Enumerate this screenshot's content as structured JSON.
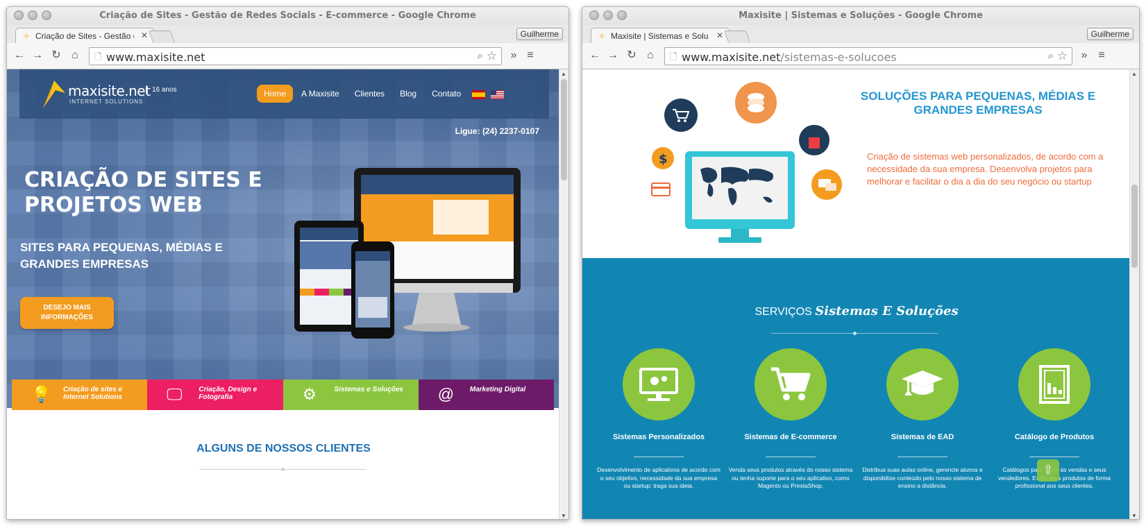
{
  "left_window": {
    "window_title": "Criação de Sites - Gestão de Redes Sociais - E-commerce - Google Chrome",
    "tab_title": "Criação de Sites - Gestão d",
    "profile": "Guilherme",
    "url_host": "www.maxisite.net",
    "url_path": "",
    "page": {
      "logo_text": "maxisite.net",
      "logo_sub": "INTERNET SOLUTIONS",
      "logo_years": "16 anos",
      "nav": [
        "Home",
        "A Maxisite",
        "Clientes",
        "Blog",
        "Contato"
      ],
      "phone": "Ligue: (24) 2237-0107",
      "hero_title": "CRIAÇÃO DE SITES E PROJETOS WEB",
      "hero_subtitle": "SITES PARA PEQUENAS, MÉDIAS E GRANDES EMPRESAS",
      "cta": "DESEJO MAIS INFORMAÇÕES",
      "services": [
        {
          "label": "Criação de sites e Internet Solutions",
          "color": "#f39c1f",
          "icon": "lightbulb-icon"
        },
        {
          "label": "Criação, Design e Fotografia",
          "color": "#ec1f62",
          "icon": "monitor-pen-icon"
        },
        {
          "label": "Sistemas e Soluções",
          "color": "#8cc63f",
          "icon": "phone-gear-icon"
        },
        {
          "label": "Marketing Digital",
          "color": "#6d1b68",
          "icon": "laptop-at-icon"
        }
      ],
      "clients_title": "ALGUNS DE NOSSOS CLIENTES"
    }
  },
  "right_window": {
    "window_title": "Maxisite | Sistemas e Soluções - Google Chrome",
    "tab_title": "Maxisite | Sistemas e Solu",
    "profile": "Guilherme",
    "url_host": "www.maxisite.net",
    "url_path": "/sistemas-e-solucoes",
    "page": {
      "solutions_title": "SOLUÇÕES PARA PEQUENAS, MÉDIAS E GRANDES EMPRESAS",
      "solutions_text": "Criação de sistemas web personalizados, de acordo com a necessidade da sua empresa. Desenvolva projetos para melhorar e facilitar o dia a dia do seu negócio ou startup",
      "services_heading": "SERVIÇOS",
      "services_heading_script": "Sistemas E Soluções",
      "cards": [
        {
          "title": "Sistemas Personalizados",
          "desc": "Desenvolvimento de aplicativos de acordo com o seu objetivo, necessidade da sua empresa ou startup: traga sua ideia.",
          "icon": "monitor-gears-icon"
        },
        {
          "title": "Sistemas de E-commerce",
          "desc": "Venda seus produtos através do nosso sistema ou tenha suporte para o seu aplicativo, como Magento ou PrestaShop.",
          "icon": "shopping-cart-icon"
        },
        {
          "title": "Sistemas de EAD",
          "desc": "Distribua suas aulas online, gerencie alunos e disponibilize conteúdo pelo nosso sistema de ensino a distância.",
          "icon": "graduation-cap-icon"
        },
        {
          "title": "Catálogo de Produtos",
          "desc": "Catálogos para apoio às vendas e seus vendedores. Exiba seus produtos de forma profissional aos seus clientes.",
          "icon": "catalog-chart-icon"
        }
      ]
    }
  },
  "colors": {
    "brand_orange": "#f39c1f",
    "brand_blue": "#1f6fb2",
    "services_bg": "#1286b3",
    "service_green": "#8cc63f",
    "solutions_text": "#ef6a3a"
  }
}
